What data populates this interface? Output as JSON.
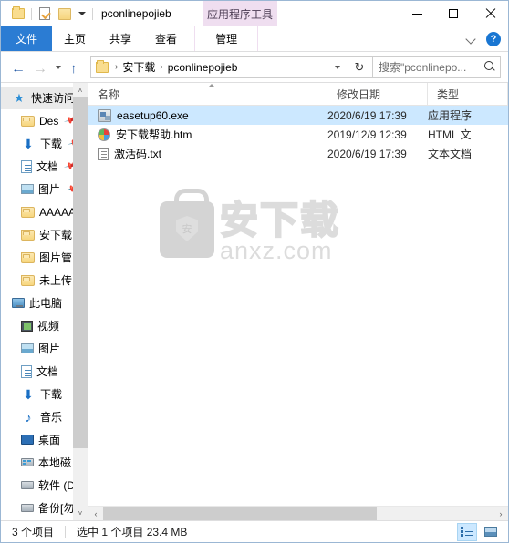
{
  "titlebar": {
    "window_title": "pconlinepojieb",
    "quick_access": [
      {
        "name": "folder-icon-1",
        "glyph": "folder"
      },
      {
        "name": "properties-icon",
        "glyph": "properties"
      },
      {
        "name": "new-folder-icon",
        "glyph": "folder"
      },
      {
        "name": "customize-caret",
        "glyph": "caret-down"
      }
    ],
    "contextual_tab_header": "应用程序工具",
    "controls": {
      "minimize": "minimize-icon",
      "maximize": "maximize-icon",
      "close": "close-icon"
    }
  },
  "ribbon": {
    "tabs": [
      {
        "label": "文件",
        "active_style": "file"
      },
      {
        "label": "主页",
        "active_style": "normal"
      },
      {
        "label": "共享",
        "active_style": "normal"
      },
      {
        "label": "查看",
        "active_style": "normal"
      }
    ],
    "contextual_tab": "管理",
    "collapse_icon": "chevron-down-icon",
    "help_label": "?"
  },
  "addressbar": {
    "back_icon": "back-arrow-icon",
    "forward_icon": "forward-arrow-icon",
    "recent_icon": "recent-locations-caret",
    "up_icon": "up-arrow-icon",
    "breadcrumbs": [
      "安下载",
      "pconlinepojieb"
    ],
    "breadcrumb_sep": "›",
    "dropdown_icon": "chevron-down-icon",
    "refresh_icon": "↻",
    "search_text": "搜索\"pconlinepo...",
    "search_icon": "search-icon"
  },
  "navpane": {
    "quick_access": {
      "label": "快速访问",
      "icon": "star-icon",
      "items": [
        {
          "label": "Des",
          "icon": "folder-icon",
          "pinned": true
        },
        {
          "label": "下载",
          "icon": "download-icon",
          "pinned": true
        },
        {
          "label": "文档",
          "icon": "documents-icon",
          "pinned": true
        },
        {
          "label": "图片",
          "icon": "pictures-icon",
          "pinned": true
        },
        {
          "label": "AAAAA",
          "icon": "folder-icon",
          "pinned": false
        },
        {
          "label": "安下载",
          "icon": "folder-icon",
          "pinned": false
        },
        {
          "label": "图片管",
          "icon": "folder-icon",
          "pinned": false
        },
        {
          "label": "未上传",
          "icon": "folder-icon",
          "pinned": false
        }
      ]
    },
    "this_pc": {
      "label": "此电脑",
      "icon": "computer-icon",
      "items": [
        {
          "label": "视频",
          "icon": "videos-icon"
        },
        {
          "label": "图片",
          "icon": "pictures-icon"
        },
        {
          "label": "文档",
          "icon": "documents-icon"
        },
        {
          "label": "下载",
          "icon": "download-icon"
        },
        {
          "label": "音乐",
          "icon": "music-icon"
        },
        {
          "label": "桌面",
          "icon": "desktop-icon"
        },
        {
          "label": "本地磁",
          "icon": "system-drive-icon"
        },
        {
          "label": "软件 (D",
          "icon": "drive-icon"
        },
        {
          "label": "备份[勿",
          "icon": "drive-icon"
        }
      ]
    },
    "scrollbar": {
      "up_arrow": "˄",
      "down_arrow": "˅"
    }
  },
  "filelist": {
    "columns": [
      {
        "key": "name",
        "label": "名称",
        "sorted": "asc"
      },
      {
        "key": "date",
        "label": "修改日期",
        "sorted": ""
      },
      {
        "key": "type",
        "label": "类型",
        "sorted": ""
      }
    ],
    "rows": [
      {
        "name": "easetup60.exe",
        "date": "2020/6/19 17:39",
        "type": "应用程序",
        "icon": "exe-icon",
        "selected": true
      },
      {
        "name": "安下载帮助.htm",
        "date": "2019/12/9 12:39",
        "type": "HTML 文",
        "icon": "html-icon",
        "selected": false
      },
      {
        "name": "激活码.txt",
        "date": "2020/6/19 17:39",
        "type": "文本文档",
        "icon": "text-icon",
        "selected": false
      }
    ],
    "watermark": {
      "logo_char": "安",
      "cn": "安下载",
      "en": "anxz.com"
    },
    "hscroll": {
      "left_arrow": "‹",
      "right_arrow": "›"
    }
  },
  "statusbar": {
    "item_count": "3 个项目",
    "selection": "选中 1 个项目  23.4 MB",
    "views": [
      {
        "name": "details-view-button",
        "active": true
      },
      {
        "name": "large-icons-view-button",
        "active": false
      }
    ]
  },
  "colors": {
    "accent": "#2b7cd3",
    "selection": "#cce8ff",
    "contextual_tab": "#efdef0",
    "window_border": "#9bb7d4"
  }
}
